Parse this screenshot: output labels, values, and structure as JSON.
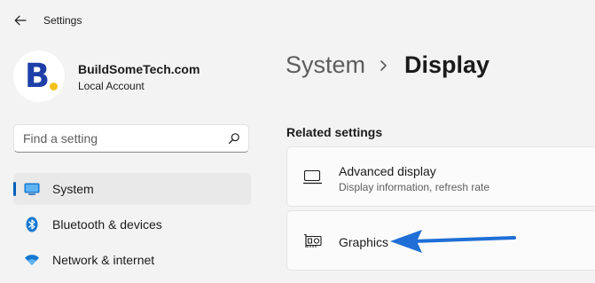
{
  "window": {
    "title": "Settings"
  },
  "profile": {
    "avatar_letter": "B",
    "name": "BuildSomeTech.com",
    "account_type": "Local Account"
  },
  "search": {
    "placeholder": "Find a setting",
    "value": ""
  },
  "sidebar": {
    "items": [
      {
        "label": "System",
        "icon": "system-monitor-icon",
        "selected": true
      },
      {
        "label": "Bluetooth & devices",
        "icon": "bluetooth-icon",
        "selected": false
      },
      {
        "label": "Network & internet",
        "icon": "wifi-icon",
        "selected": false
      }
    ]
  },
  "header": {
    "breadcrumb_parent": "System",
    "breadcrumb_current": "Display"
  },
  "related_settings": {
    "title": "Related settings",
    "cards": [
      {
        "title": "Advanced display",
        "subtitle": "Display information, refresh rate",
        "icon": "monitor-icon"
      },
      {
        "title": "Graphics",
        "subtitle": "",
        "icon": "graphics-card-icon"
      }
    ]
  },
  "annotation": {
    "arrow_color": "#1f6fd6",
    "points_to": "Graphics"
  },
  "colors": {
    "accent": "#005fb8",
    "background": "#f3f3f3",
    "card": "#fbfbfb",
    "avatar_dot": "#f2c21b",
    "avatar_letter": "#1f3fa8"
  }
}
